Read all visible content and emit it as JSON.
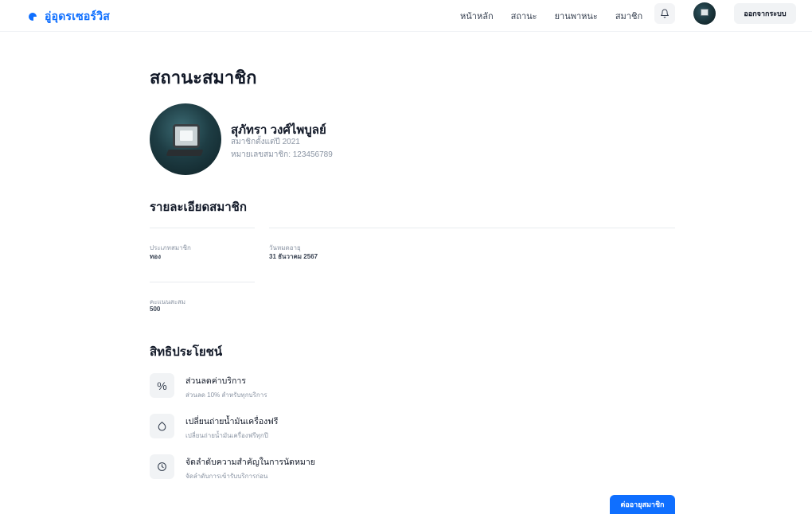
{
  "brand": {
    "name": "อู่อุดรเซอร์วิส",
    "accent": "#0f6fff"
  },
  "nav": {
    "items": [
      "หน้าหลัก",
      "สถานะ",
      "ยานพาหนะ",
      "สมาชิก"
    ],
    "logout_label": "ออกจากระบบ",
    "bell_icon": "bell-icon"
  },
  "page": {
    "title": "สถานะสมาชิก"
  },
  "profile": {
    "name": "สุภัทรา วงศ์ไพบูลย์",
    "since": "สมาชิกตั้งแต่ปี 2021",
    "member_no": "หมายเลขสมาชิก: 123456789"
  },
  "details": {
    "title": "รายละเอียดสมาชิก",
    "fields": [
      {
        "label": "ประเภทสมาชิก",
        "value": "ทอง"
      },
      {
        "label": "วันหมดอายุ",
        "value": "31 ธันวาคม 2567"
      },
      {
        "label": "คะแนนสะสม",
        "value": "500"
      }
    ]
  },
  "benefits": {
    "title": "สิทธิประโยชน์",
    "items": [
      {
        "icon": "percent-icon",
        "title": "ส่วนลดค่าบริการ",
        "desc": "ส่วนลด 10% สำหรับทุกบริการ"
      },
      {
        "icon": "oil-drop-icon",
        "title": "เปลี่ยนถ่ายน้ำมันเครื่องฟรี",
        "desc": "เปลี่ยนถ่ายน้ำมันเครื่องฟรีทุกปี"
      },
      {
        "icon": "clock-icon",
        "title": "จัดลำดับความสำคัญในการนัดหมาย",
        "desc": "จัดลำดับการเข้ารับบริการก่อน"
      }
    ]
  },
  "actions": {
    "renew_label": "ต่ออายุสมาชิก"
  }
}
